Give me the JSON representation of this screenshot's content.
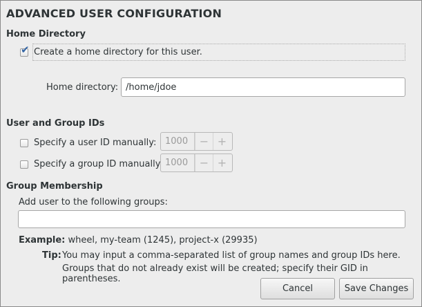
{
  "dialog": {
    "title": "ADVANCED USER CONFIGURATION"
  },
  "home": {
    "section_title": "Home Directory",
    "create_home_label": "Create a home directory for this user.",
    "create_home_checked": true,
    "directory_label": "Home directory:",
    "directory_value": "/home/jdoe"
  },
  "ids": {
    "section_title": "User and Group IDs",
    "user_id_label": "Specify a user ID manually:",
    "user_id_value": "1000",
    "group_id_label": "Specify a group ID manually:",
    "group_id_value": "1000",
    "minus": "−",
    "plus": "+"
  },
  "groups": {
    "section_title": "Group Membership",
    "prompt": "Add user to the following groups:",
    "value": "",
    "example_label": "Example:",
    "example_text": "wheel, my-team (1245), project-x (29935)",
    "tip_label": "Tip:",
    "tip_line1": "You may input a comma-separated list of group names and group IDs here.",
    "tip_line2": "Groups that do not already exist will be created; specify their GID in parentheses."
  },
  "actions": {
    "cancel_label": "Cancel",
    "save_label": "Save Changes"
  },
  "colors": {
    "background": "#ededed",
    "accent": "#3465a4"
  }
}
